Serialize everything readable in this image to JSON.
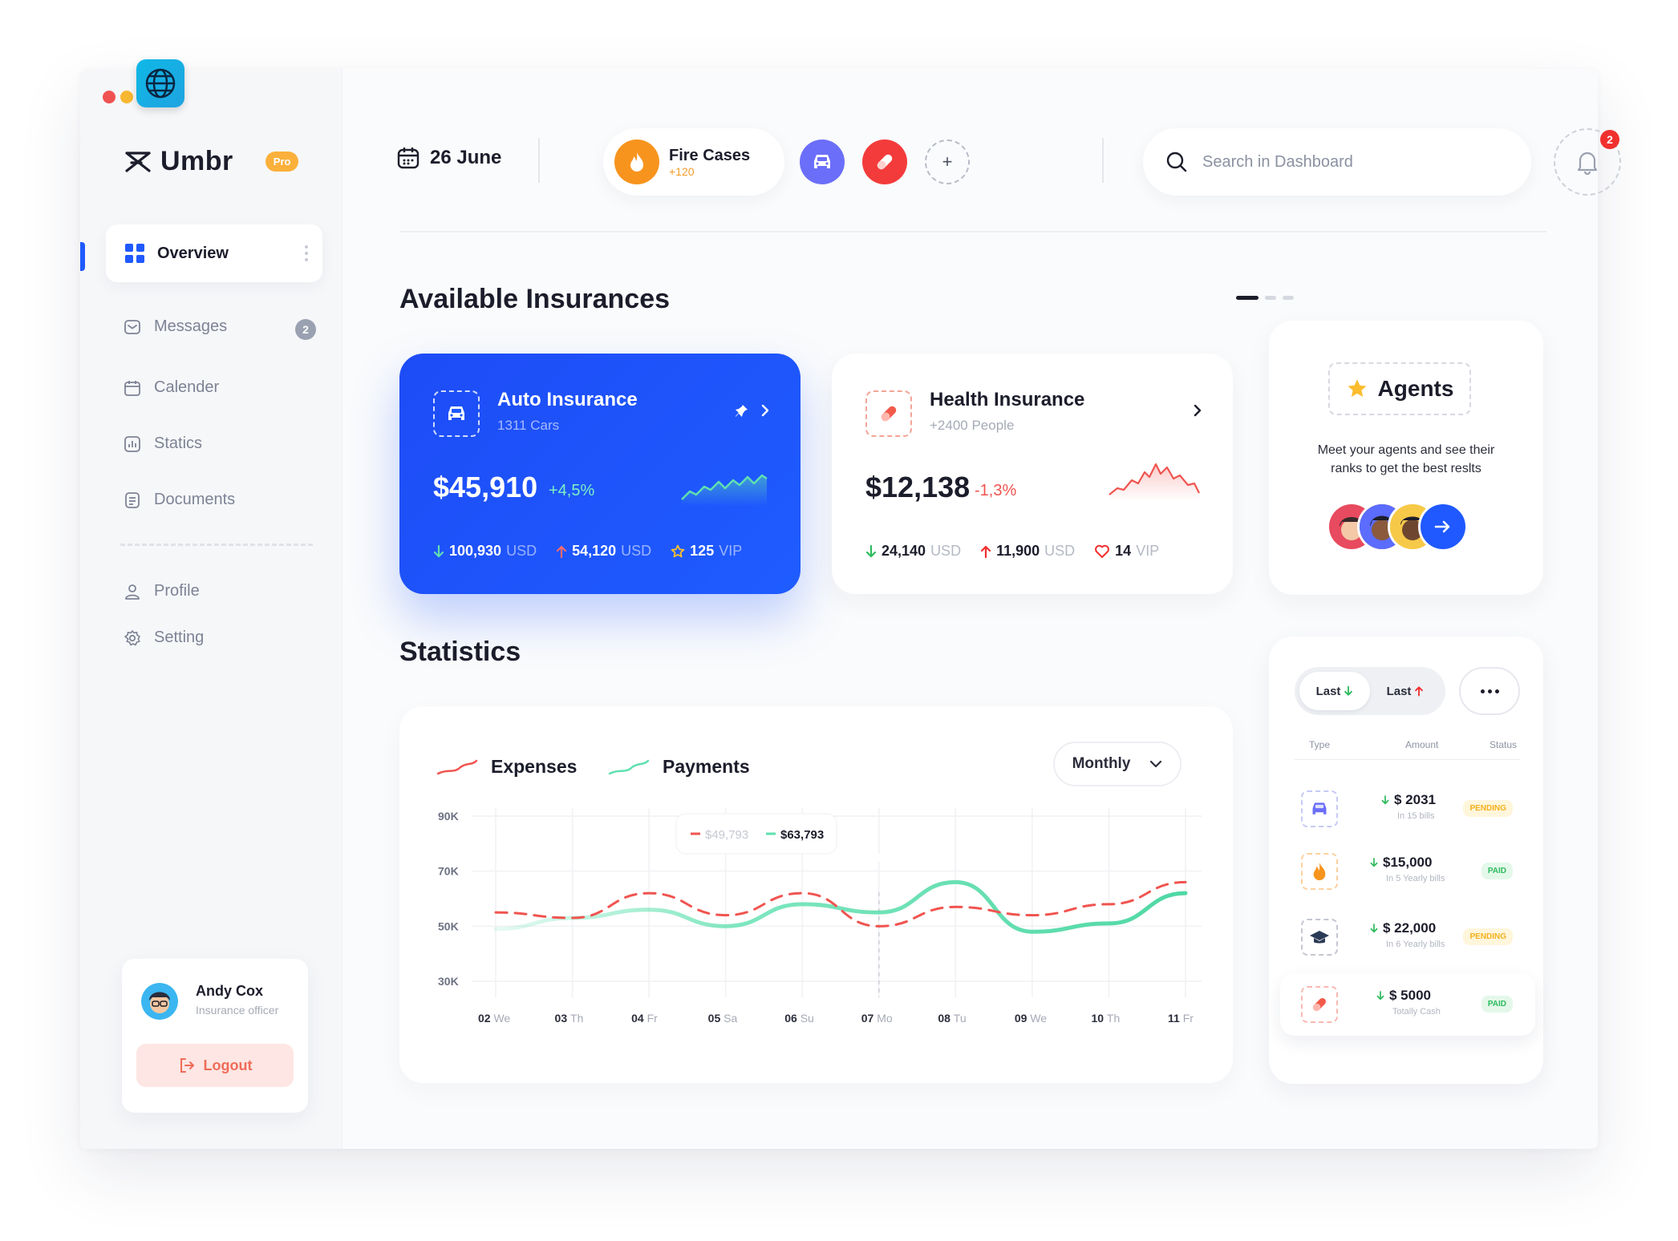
{
  "app": {
    "name": "Umbr",
    "badge": "Pro"
  },
  "nav": {
    "overview": "Overview",
    "items": [
      {
        "label": "Messages",
        "icon": "envelope-icon",
        "badge": "2"
      },
      {
        "label": "Calender",
        "icon": "calendar-icon"
      },
      {
        "label": "Statics",
        "icon": "bar-chart-icon"
      },
      {
        "label": "Documents",
        "icon": "document-icon"
      },
      {
        "label": "Profile",
        "icon": "user-icon"
      },
      {
        "label": "Setting",
        "icon": "gear-icon"
      }
    ]
  },
  "user": {
    "name": "Andy Cox",
    "role": "Insurance officer",
    "logout": "Logout"
  },
  "header": {
    "date": "26 June",
    "fire": {
      "title": "Fire Cases",
      "sub": "+120"
    },
    "search_placeholder": "Search in Dashboard",
    "notifications": "2"
  },
  "insurances": {
    "title": "Available Insurances",
    "auto": {
      "title": "Auto Insurance",
      "sub": "1311 Cars",
      "amount": "$45,910",
      "change": "+4,5%",
      "stats": [
        {
          "value": "100,930",
          "unit": "USD"
        },
        {
          "value": "54,120",
          "unit": "USD"
        },
        {
          "value": "125",
          "unit": "VIP"
        }
      ]
    },
    "health": {
      "title": "Health Insurance",
      "sub": "+2400 People",
      "amount": "$12,138",
      "change": "-1,3%",
      "stats": [
        {
          "value": "24,140",
          "unit": "USD"
        },
        {
          "value": "11,900",
          "unit": "USD"
        },
        {
          "value": "14",
          "unit": "VIP"
        }
      ]
    },
    "agents": {
      "title": "Agents",
      "desc": "Meet your agents and see their ranks to get the best reslts"
    }
  },
  "statistics": {
    "title": "Statistics",
    "filter": "Monthly",
    "tooltip": {
      "expenses": "$49,793",
      "payments": "$63,793"
    }
  },
  "chart_data": {
    "type": "line",
    "x": [
      "02 We",
      "03 Th",
      "04 Fr",
      "05 Sa",
      "06 Su",
      "07 Mo",
      "08 Tu",
      "09 We",
      "10 Th",
      "11 Fr"
    ],
    "y_ticks": [
      "90K",
      "70K",
      "50K",
      "30K"
    ],
    "ylim": [
      30000,
      90000
    ],
    "series": [
      {
        "name": "Expenses",
        "color": "#f0544f",
        "values": [
          55000,
          53000,
          62000,
          54000,
          62000,
          50000,
          57000,
          54000,
          58000,
          66000
        ]
      },
      {
        "name": "Payments",
        "color": "#5fe0b0",
        "values": [
          49000,
          53000,
          56000,
          50000,
          58000,
          55000,
          66000,
          48000,
          51000,
          62000
        ]
      }
    ]
  },
  "transactions": {
    "toggle": [
      {
        "label": "Last"
      },
      {
        "label": "Last"
      }
    ],
    "headers": {
      "type": "Type",
      "amount": "Amount",
      "status": "Status"
    },
    "rows": [
      {
        "icon": "car-icon",
        "amount": "$ 2031",
        "note": "In 15 bills",
        "status": "PENDING"
      },
      {
        "icon": "fire-icon",
        "amount": "$15,000",
        "note": "In 5 Yearly bills",
        "status": "PAID"
      },
      {
        "icon": "graduation-cap-icon",
        "amount": "$ 22,000",
        "note": "In 6 Yearly bills",
        "status": "PENDING"
      },
      {
        "icon": "pill-icon",
        "amount": "$ 5000",
        "note": "Totally Cash",
        "status": "PAID"
      }
    ]
  }
}
